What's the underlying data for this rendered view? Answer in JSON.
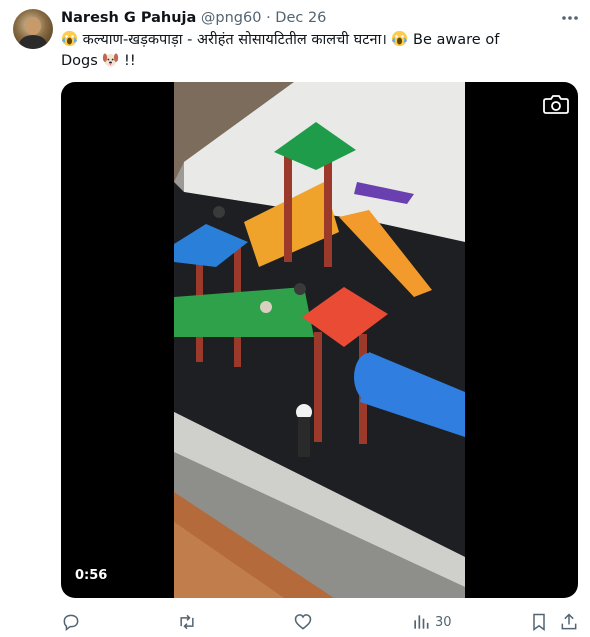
{
  "tweet": {
    "display_name": "Naresh G Pahuja",
    "handle": "@png60",
    "separator": "·",
    "date": "Dec 26",
    "text_line1": "कल्याण-खड़कपाड़ा - अरीहंत सोसायटितील कालची घटना।",
    "text_line1_tail": "Be aware of",
    "text_line2": "Dogs",
    "text_line2_tail": "!!",
    "emoji": {
      "scream": "scream-emoji",
      "dog": "dog-face-emoji"
    }
  },
  "media": {
    "duration": "0:56",
    "camera_icon": "camera-icon"
  },
  "actions": {
    "reply": {
      "icon": "reply-icon"
    },
    "retweet": {
      "icon": "retweet-icon"
    },
    "like": {
      "icon": "like-icon"
    },
    "views": {
      "icon": "views-icon",
      "count": "30"
    },
    "bookmark": {
      "icon": "bookmark-icon"
    },
    "share": {
      "icon": "share-icon"
    }
  },
  "colors": {
    "text_primary": "#0f1419",
    "text_secondary": "#536471",
    "media_bg": "#000000"
  }
}
